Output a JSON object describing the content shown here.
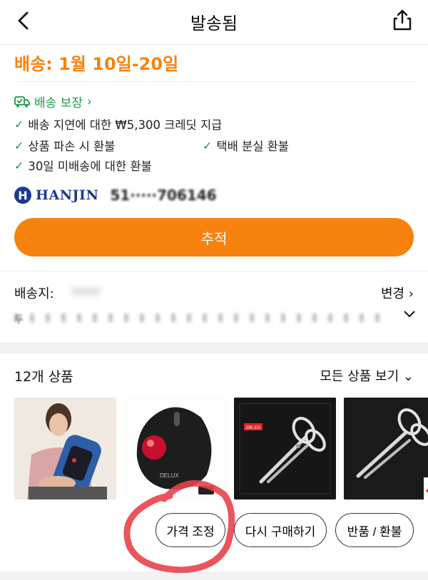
{
  "header": {
    "title": "발송됨"
  },
  "shipping": {
    "eta": "배송: 1월 10일-20일",
    "guarantee": "배송 보장",
    "items": [
      "배송 지연에 대한 ₩5,300 크레딧 지급",
      "상품 파손 시 환불",
      "택배 분실 환불",
      "30일 미배송에 대한 환불"
    ],
    "carrier": "HANJIN",
    "carrier_badge": "H",
    "tracking": "51·····706146",
    "track_button": "추적"
  },
  "address": {
    "label": "배송지:",
    "change": "변경",
    "first_char": "두"
  },
  "products": {
    "count_label": "12개 상품",
    "view_all": "모든 상품 보기",
    "thumbs": [
      "hand-massager-product",
      "trackball-mouse-product",
      "kitchen-scissors-product",
      "kitchen-scissors-product-2"
    ],
    "mouse_brand": "DELUX",
    "scissors_tag": "20K-EG",
    "buttons": {
      "price_adjust": "가격 조정",
      "buy_again": "다시 구매하기",
      "return": "반품 / 환불"
    }
  },
  "colors": {
    "accent": "#f7820e",
    "green": "#1f9a46",
    "annotation": "#e8414a"
  }
}
